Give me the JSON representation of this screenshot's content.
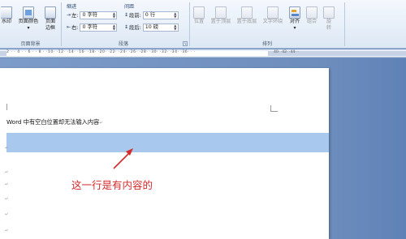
{
  "ribbon": {
    "buttons": [
      {
        "label": "水印",
        "sub": ""
      },
      {
        "label": "页面颜色",
        "sub": ""
      },
      {
        "label": "页面",
        "sub": "边框"
      },
      {
        "label": "位置",
        "sub": ""
      },
      {
        "label": "置于顶层",
        "sub": ""
      },
      {
        "label": "置于底层",
        "sub": ""
      },
      {
        "label": "文字环绕",
        "sub": ""
      },
      {
        "label": "对齐",
        "sub": ""
      },
      {
        "label": "组合",
        "sub": ""
      },
      {
        "label": "旋",
        "sub": "转"
      }
    ],
    "indent": {
      "title": "缩进",
      "left_label": "左:",
      "left_value": "0 字符",
      "right_label": "右:",
      "right_value": "0 字符"
    },
    "spacing": {
      "title": "间距",
      "before_label": "段前:",
      "before_value": "0 行",
      "after_label": "段后:",
      "after_value": "10 磅"
    },
    "groups": {
      "page_background": "页面背景",
      "paragraph": "段落",
      "arrange": "排列"
    }
  },
  "ruler": {
    "ticks": "2 · · 4 · · 6 · · 8 · ·10· ·12· ·14· ·16· ·18· ·20· ·22· ·24· ·26· ·28· ·30· ·32· ·34· ·36· · ·",
    "ticks_right": "40· ·42· ·44· ·"
  },
  "document": {
    "title": "Word 中有空白位置却无法输入内容",
    "para_mark": "↵",
    "annotation": "这一行是有内容的"
  },
  "colors": {
    "highlight": "#a9c8ee",
    "annotation": "#d52b2b",
    "page_bg": "#ffffff",
    "desktop_bg": "#6f8fbf"
  }
}
